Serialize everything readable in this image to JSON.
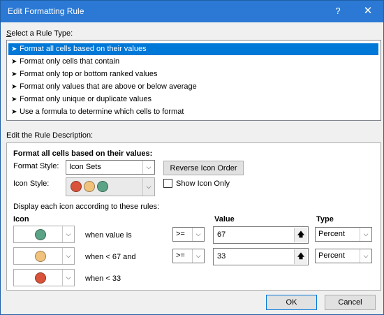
{
  "window": {
    "title": "Edit Formatting Rule",
    "help_glyph": "?",
    "close_glyph": "✕"
  },
  "rule_type": {
    "label": "Select a Rule Type:",
    "items": [
      {
        "label": "Format all cells based on their values",
        "selected": true
      },
      {
        "label": "Format only cells that contain",
        "selected": false
      },
      {
        "label": "Format only top or bottom ranked values",
        "selected": false
      },
      {
        "label": "Format only values that are above or below average",
        "selected": false
      },
      {
        "label": "Format only unique or duplicate values",
        "selected": false
      },
      {
        "label": "Use a formula to determine which cells to format",
        "selected": false
      }
    ]
  },
  "description": {
    "label": "Edit the Rule Description:",
    "heading": "Format all cells based on their values:",
    "format_style_label": "Format Style:",
    "format_style_value": "Icon Sets",
    "reverse_button": "Reverse Icon Order",
    "icon_style_label": "Icon Style:",
    "icon_style_colors": [
      "#d9533a",
      "#f0c27b",
      "#5aa386"
    ],
    "show_icon_only_label": "Show Icon Only",
    "show_icon_only_checked": false,
    "rules_label": "Display each icon according to these rules:",
    "col_icon": "Icon",
    "col_value": "Value",
    "col_type": "Type",
    "rows": [
      {
        "icon_color": "#5aa386",
        "condition": "when value is",
        "operator": ">=",
        "value": "67",
        "type": "Percent"
      },
      {
        "icon_color": "#f0c27b",
        "condition": "when < 67 and",
        "operator": ">=",
        "value": "33",
        "type": "Percent"
      },
      {
        "icon_color": "#d9533a",
        "condition": "when < 33"
      }
    ]
  },
  "buttons": {
    "ok": "OK",
    "cancel": "Cancel"
  },
  "icons": {
    "dropdown": "chevron-down-icon",
    "rule_arrow": "arrow-right-icon",
    "ref": "collapse-arrow-icon"
  }
}
